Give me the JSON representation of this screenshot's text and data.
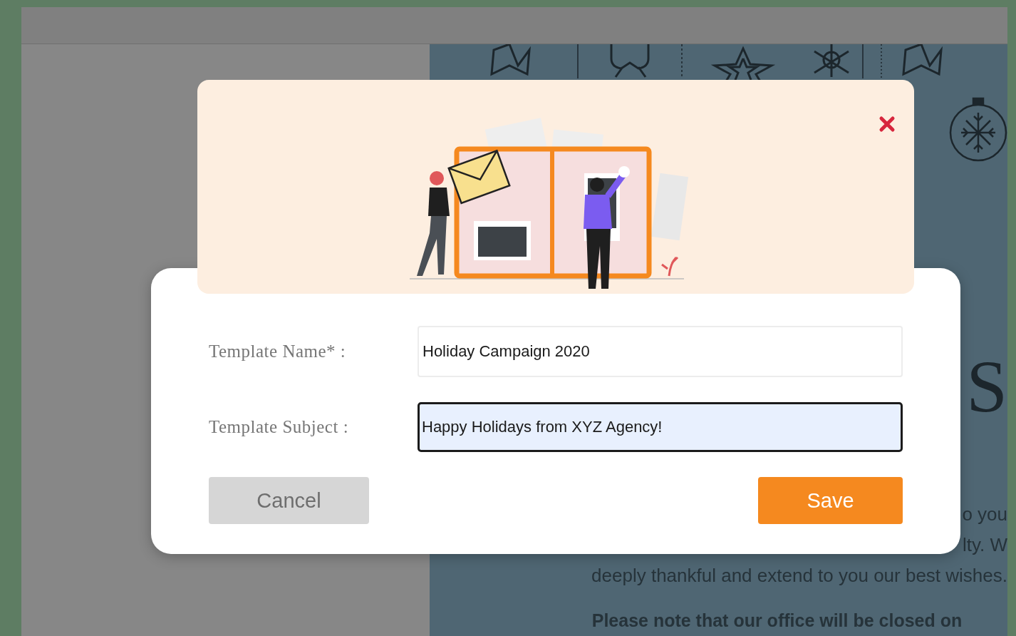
{
  "background_page": {
    "heading": "S",
    "lines": [
      {
        "text": "o you",
        "bold": false
      },
      {
        "text": "lty. W",
        "bold": false
      },
      {
        "text": "deeply thankful and extend to you our best wishes.",
        "bold": false
      },
      {
        "text": "Please note that our office will be closed on",
        "bold": true
      }
    ]
  },
  "dialog": {
    "fields": [
      {
        "label": "Template Name* :",
        "value": "Holiday Campaign 2020",
        "focused": false
      },
      {
        "label": "Template Subject :",
        "value": "Happy Holidays from XYZ Agency!",
        "focused": true
      }
    ],
    "buttons": [
      {
        "label": "Cancel",
        "kind": "secondary"
      },
      {
        "label": "Save",
        "kind": "primary"
      }
    ]
  }
}
